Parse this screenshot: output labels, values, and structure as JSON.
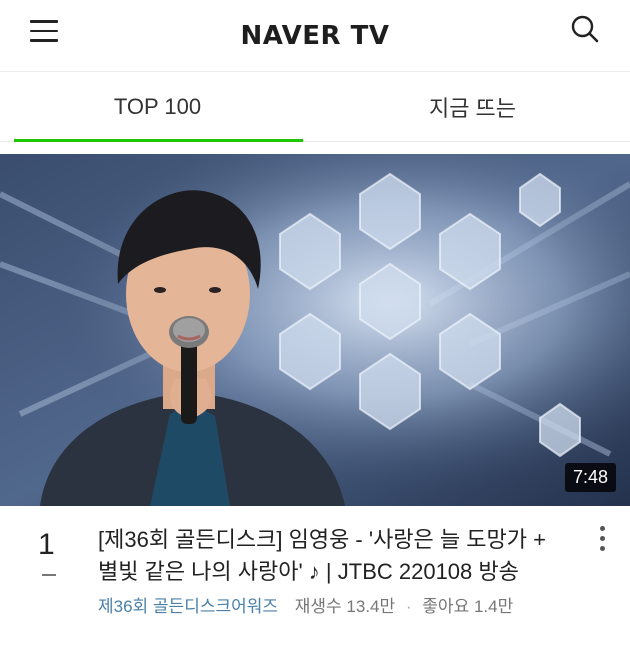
{
  "header": {
    "logo": "NAVER TV",
    "menu_icon": "hamburger-menu-icon",
    "search_icon": "search-icon"
  },
  "tabs": [
    {
      "label": "TOP 100",
      "active": true
    },
    {
      "label": "지금 뜨는",
      "active": false
    }
  ],
  "video": {
    "duration": "7:48",
    "rank": "1",
    "title": "[제36회 골든디스크] 임영웅 - '사랑은 늘 도망가 + 별빛 같은 나의 사랑아' ♪ | JTBC 220108 방송",
    "channel": "제36회 골든디스크어워즈",
    "views": "재생수 13.4만",
    "likes": "좋아요 1.4만",
    "more_icon": "more-vertical-icon"
  },
  "colors": {
    "accent": "#1ec800",
    "channel": "#4a80a8"
  }
}
